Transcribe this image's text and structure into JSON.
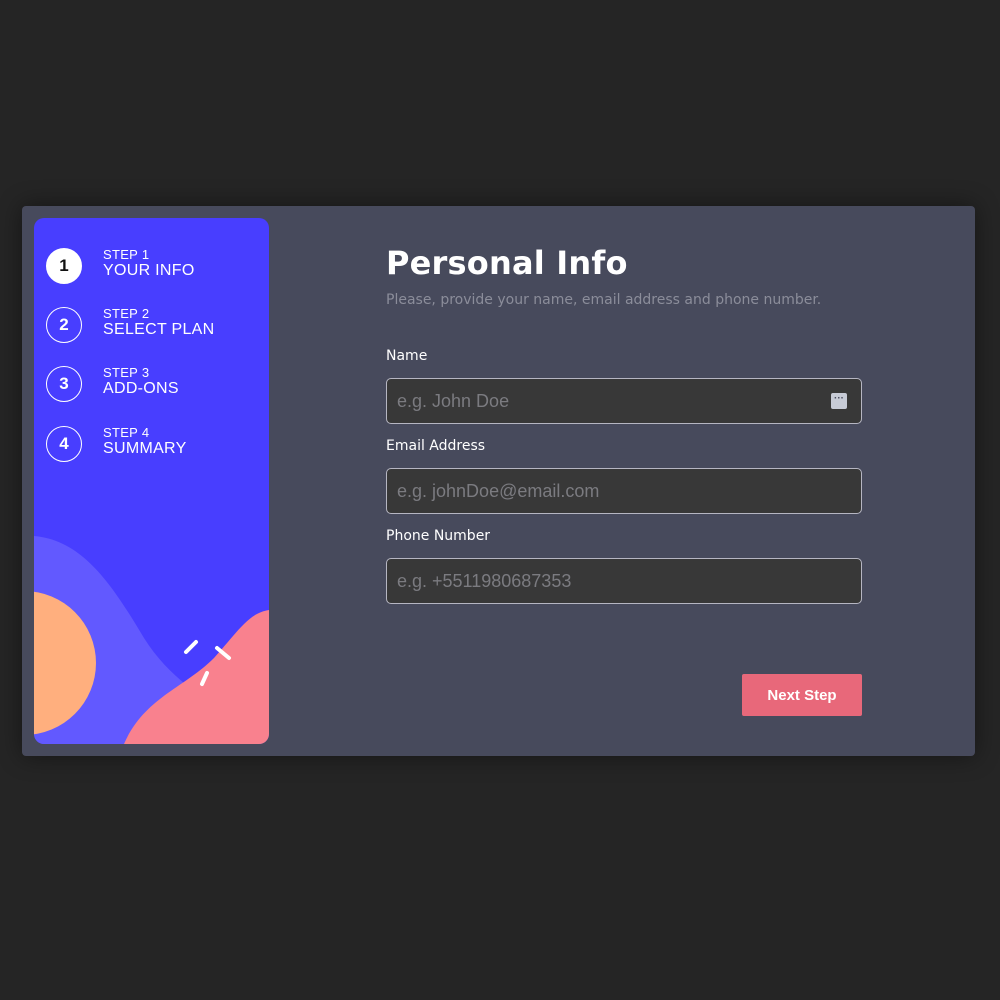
{
  "colors": {
    "background": "#252525",
    "card": "#474a5c",
    "sidebar": "#483eff",
    "accent_button": "#e8687a",
    "shape_light_purple": "#6259ff",
    "shape_orange": "#ffaf7e",
    "shape_pink": "#f9818e"
  },
  "sidebar": {
    "steps": [
      {
        "number": "1",
        "label": "STEP 1",
        "title": "YOUR INFO",
        "active": true
      },
      {
        "number": "2",
        "label": "STEP 2",
        "title": "SELECT PLAN",
        "active": false
      },
      {
        "number": "3",
        "label": "STEP 3",
        "title": "ADD-ONS",
        "active": false
      },
      {
        "number": "4",
        "label": "STEP 4",
        "title": "SUMMARY",
        "active": false
      }
    ]
  },
  "form": {
    "title": "Personal Info",
    "subtitle": "Please, provide your name, email address and phone number.",
    "fields": [
      {
        "label": "Name",
        "value": "",
        "placeholder": "e.g. John Doe"
      },
      {
        "label": "Email Address",
        "value": "",
        "placeholder": "e.g. johnDoe@email.com"
      },
      {
        "label": "Phone Number",
        "value": "",
        "placeholder": "e.g. +5511980687353"
      }
    ],
    "autofill_icon": "autofill-icon",
    "next_label": "Next Step"
  }
}
